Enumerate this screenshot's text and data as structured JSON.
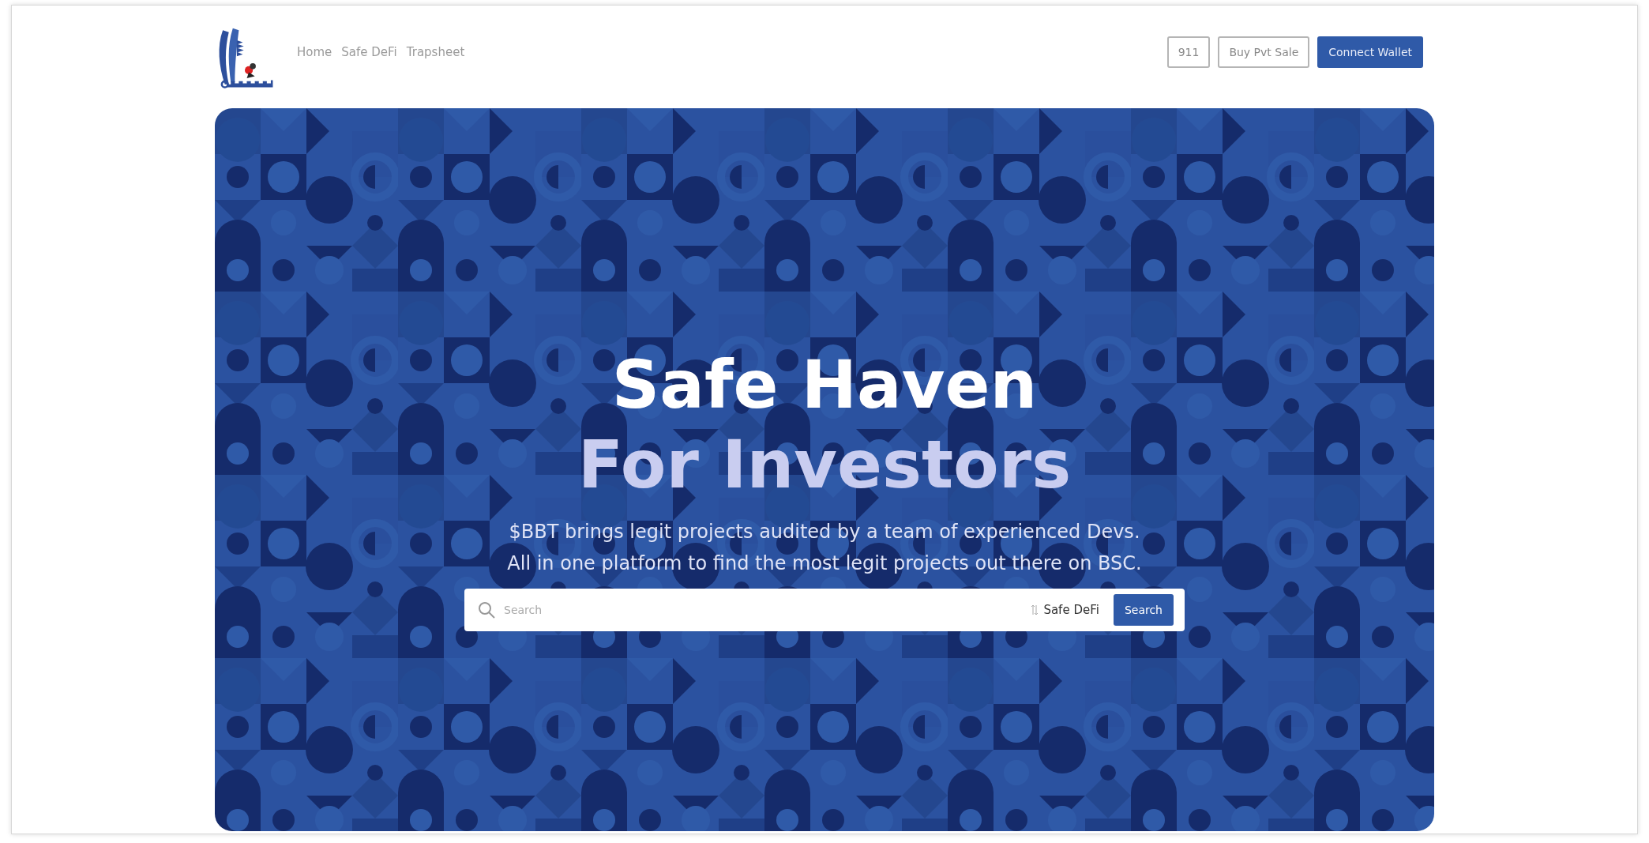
{
  "header": {
    "nav": [
      {
        "label": "Home"
      },
      {
        "label": "Safe DeFi"
      },
      {
        "label": "Trapsheet"
      }
    ],
    "buttons": [
      {
        "label": "911",
        "kind": "outline"
      },
      {
        "label": "Buy Pvt Sale",
        "kind": "outline"
      },
      {
        "label": "Connect Wallet",
        "kind": "primary"
      }
    ]
  },
  "hero": {
    "title_lines": [
      "Safe Haven",
      "For Investors"
    ],
    "subtitle_lines": [
      "$BBT brings legit projects audited by a team of experienced Devs.",
      "All in one platform to find the most legit projects out there on BSC."
    ],
    "search": {
      "placeholder": "Search",
      "filter": "Safe DeFi",
      "button": "Search"
    }
  }
}
